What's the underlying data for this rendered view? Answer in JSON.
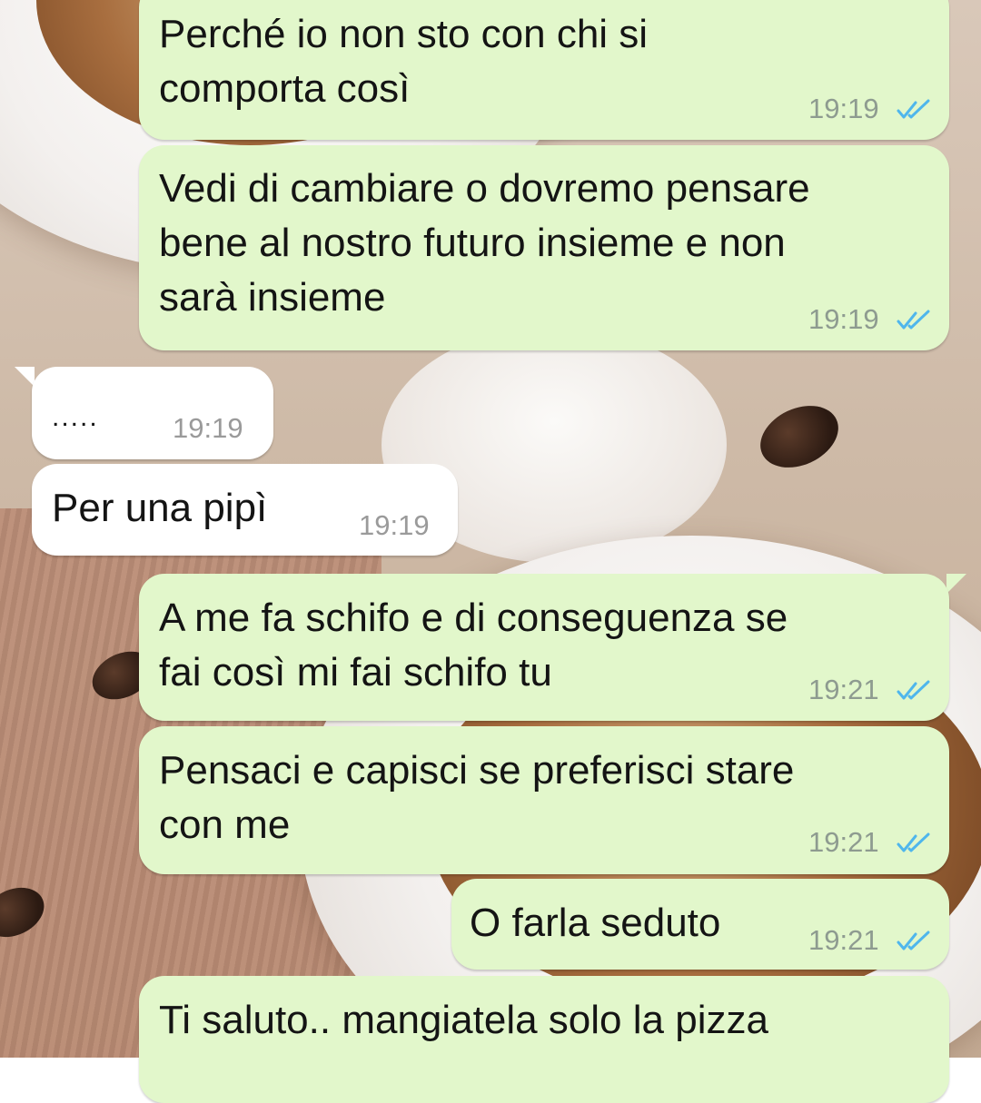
{
  "chat": {
    "messages": [
      {
        "direction": "out",
        "text": "Perché io non sto con chi si\ncomporta così",
        "time": "19:19",
        "status": "read"
      },
      {
        "direction": "out",
        "text": "Vedi di cambiare o dovremo pensare\nbene al nostro futuro insieme e non\nsarà insieme",
        "time": "19:19",
        "status": "read"
      },
      {
        "direction": "in",
        "text": ".....",
        "time": "19:19"
      },
      {
        "direction": "in",
        "text": "Per una pipì",
        "time": "19:19"
      },
      {
        "direction": "out",
        "text": "A me fa schifo e di conseguenza se\nfai così mi fai schifo tu",
        "time": "19:21",
        "status": "read"
      },
      {
        "direction": "out",
        "text": "Pensaci e capisci se preferisci stare\ncon me",
        "time": "19:21",
        "status": "read"
      },
      {
        "direction": "out",
        "text": "O farla seduto",
        "time": "19:21",
        "status": "read"
      },
      {
        "direction": "out",
        "text": "Ti saluto.. mangiatela solo la pizza",
        "time": "",
        "status": ""
      }
    ]
  },
  "colors": {
    "outgoing_bubble": "#e2f7cb",
    "incoming_bubble": "#ffffff",
    "read_tick": "#4fb6ec"
  },
  "icons": {
    "read_receipt": "double-check-icon"
  }
}
